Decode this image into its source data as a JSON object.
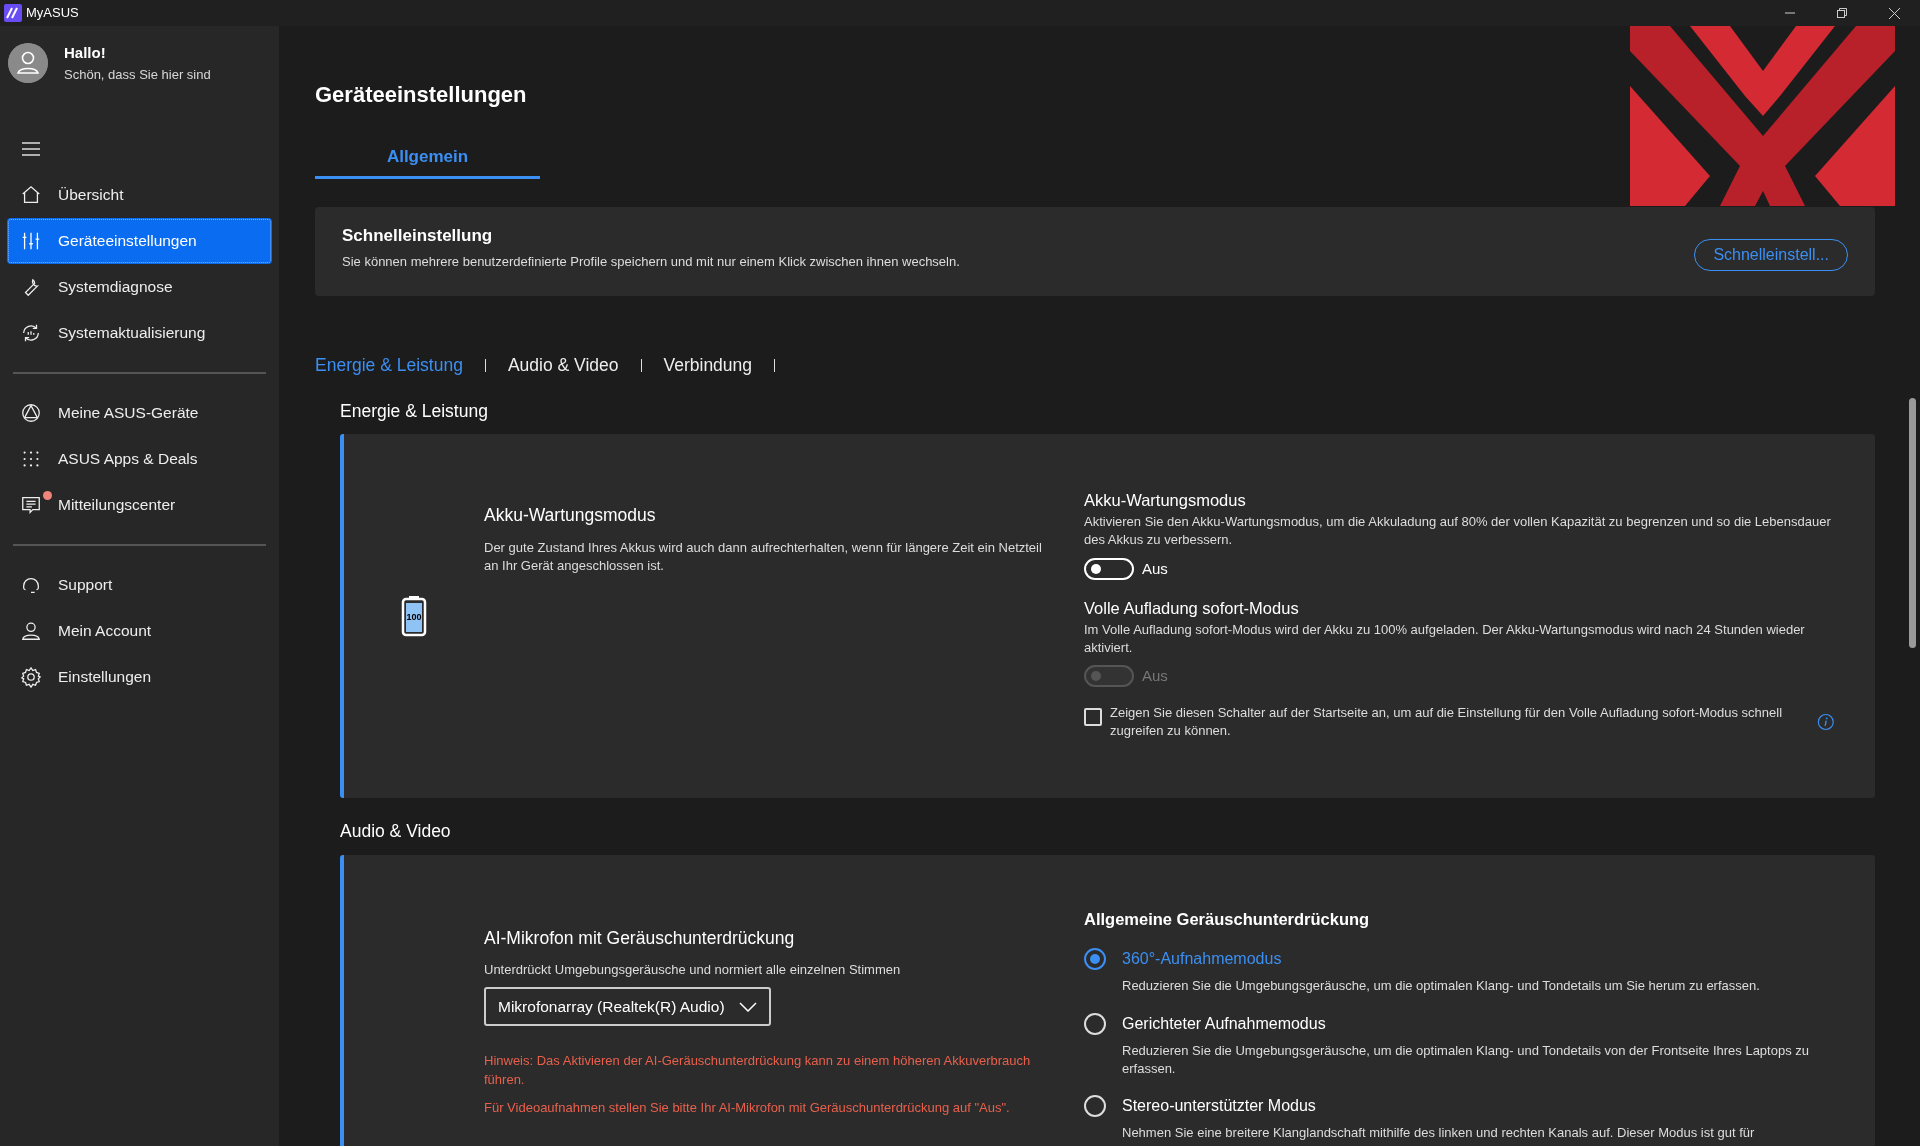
{
  "window": {
    "title": "MyASUS"
  },
  "user": {
    "greeting": "Hallo!",
    "subtitle": "Schön, dass Sie hier sind"
  },
  "sidebar": {
    "groups": [
      [
        {
          "label": "Übersicht",
          "kind": "home",
          "selected": false,
          "notification": false
        },
        {
          "label": "Geräteeinstellungen",
          "kind": "sliders",
          "selected": true,
          "notification": false
        },
        {
          "label": "Systemdiagnose",
          "kind": "wrench",
          "selected": false,
          "notification": false
        },
        {
          "label": "Systemaktualisierung",
          "kind": "update",
          "selected": false,
          "notification": false
        }
      ],
      [
        {
          "label": "Meine ASUS-Geräte",
          "kind": "devices",
          "selected": false,
          "notification": false
        },
        {
          "label": "ASUS Apps & Deals",
          "kind": "apps",
          "selected": false,
          "notification": false
        },
        {
          "label": "Mitteilungscenter",
          "kind": "messages",
          "selected": false,
          "notification": true
        }
      ],
      [
        {
          "label": "Support",
          "kind": "support",
          "selected": false,
          "notification": false
        },
        {
          "label": "Mein Account",
          "kind": "user",
          "selected": false,
          "notification": false
        },
        {
          "label": "Einstellungen",
          "kind": "gear",
          "selected": false,
          "notification": false
        }
      ]
    ]
  },
  "page": {
    "title": "Geräteeinstellungen",
    "tabs": [
      {
        "label": "Allgemein",
        "selected": true
      }
    ]
  },
  "quick_setting": {
    "title": "Schnelleinstellung",
    "description": "Sie können mehrere benutzerdefinierte Profile speichern und mit nur einem Klick zwischen ihnen wechseln.",
    "button": "Schnelleinstell..."
  },
  "section_tabs": [
    {
      "label": "Energie & Leistung",
      "selected": true
    },
    {
      "label": "Audio & Video",
      "selected": false
    },
    {
      "label": "Verbindung",
      "selected": false
    }
  ],
  "sections": [
    {
      "title": "Energie & Leistung",
      "left": {
        "kind": "battery",
        "battery_label": "100",
        "title": "Akku-Wartungsmodus",
        "description": "Der gute Zustand Ihres Akkus wird auch dann aufrechterhalten, wenn für längere Zeit ein Netzteil an Ihr Gerät angeschlossen ist."
      },
      "right": {
        "items": [
          {
            "kind": "toggle",
            "title": "Akku-Wartungsmodus",
            "description": "Aktivieren Sie den Akku-Wartungsmodus, um die Akkuladung auf 80% der vollen Kapazität zu begrenzen und so die Lebensdauer des Akkus zu verbessern.",
            "on": false,
            "disabled": false,
            "state_label": "Aus"
          },
          {
            "kind": "toggle",
            "title": "Volle Aufladung sofort-Modus",
            "description": "Im Volle Aufladung sofort-Modus wird der Akku zu 100% aufgeladen. Der Akku-Wartungsmodus wird nach 24 Stunden wieder aktiviert.",
            "on": false,
            "disabled": true,
            "state_label": "Aus"
          },
          {
            "kind": "checkbox",
            "label": "Zeigen Sie diesen Schalter auf der Startseite an, um auf die Einstellung für den Volle Aufladung sofort-Modus schnell zugreifen zu können.",
            "checked": false
          }
        ]
      }
    },
    {
      "title": "Audio & Video",
      "left": {
        "kind": "microphone",
        "title": "AI-Mikrofon mit Geräuschunterdrückung",
        "description": "Unterdrückt Umgebungsgeräusche und normiert alle einzelnen Stimmen",
        "dropdown": "Mikrofonarray (Realtek(R) Audio)",
        "warnings": [
          "Hinweis: Das Aktivieren der AI-Geräuschunterdrückung kann zu einem höheren Akkuverbrauch führen.",
          "Für Videoaufnahmen stellen Sie bitte Ihr AI-Mikrofon mit Geräuschunterdrückung auf \"Aus\"."
        ]
      },
      "right": {
        "title": "Allgemeine Geräuschunterdrückung",
        "items": [
          {
            "kind": "radio",
            "label": "360°-Aufnahmemodus",
            "description": "Reduzieren Sie die Umgebungsgeräusche, um die optimalen Klang- und Tondetails um Sie herum zu erfassen.",
            "selected": true
          },
          {
            "kind": "radio",
            "label": "Gerichteter Aufnahmemodus",
            "description": "Reduzieren Sie die Umgebungsgeräusche, um die optimalen Klang- und Tondetails von der Frontseite Ihres Laptops zu erfassen.",
            "selected": false
          },
          {
            "kind": "radio",
            "label": "Stereo-unterstützter Modus",
            "description": "Nehmen Sie eine breitere Klanglandschaft mithilfe des linken und rechten Kanals auf. Dieser Modus ist gut für",
            "selected": false
          }
        ]
      }
    }
  ]
}
